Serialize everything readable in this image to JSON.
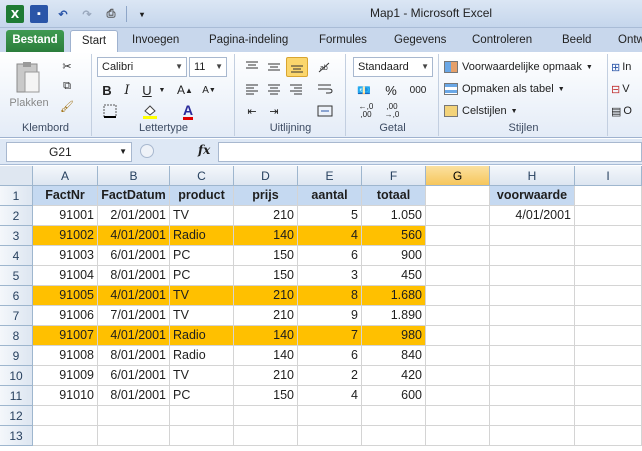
{
  "window": {
    "title": "Map1  -  Microsoft Excel"
  },
  "qat": {
    "app_icon": "excel-icon",
    "items": [
      "save-icon",
      "undo-icon",
      "redo-icon",
      "print-preview-icon"
    ]
  },
  "tabs": [
    {
      "label": "Bestand"
    },
    {
      "label": "Start"
    },
    {
      "label": "Invoegen"
    },
    {
      "label": "Pagina-indeling"
    },
    {
      "label": "Formules"
    },
    {
      "label": "Gegevens"
    },
    {
      "label": "Controleren"
    },
    {
      "label": "Beeld"
    },
    {
      "label": "Ontw"
    }
  ],
  "ribbon": {
    "clipboard": {
      "label": "Klembord",
      "paste": "Plakken"
    },
    "font": {
      "label": "Lettertype",
      "name": "Calibri",
      "size": "11",
      "bold": "B",
      "italic": "I",
      "underline": "U",
      "font_color": "A"
    },
    "alignment": {
      "label": "Uitlijning"
    },
    "number": {
      "label": "Getal",
      "format": "Standaard",
      "percent": "%",
      "thousands": "000"
    },
    "styles": {
      "label": "Stijlen",
      "conditional": "Voorwaardelijke opmaak",
      "table": "Opmaken als tabel",
      "cell_styles": "Celstijlen"
    },
    "cells": {
      "items": [
        "In",
        "V",
        "O"
      ]
    }
  },
  "formula_bar": {
    "name_box": "G21",
    "fx": "fx",
    "value": ""
  },
  "columns": [
    "A",
    "B",
    "C",
    "D",
    "E",
    "F",
    "G",
    "H",
    "I"
  ],
  "selected_column": "G",
  "rows": [
    "1",
    "2",
    "3",
    "4",
    "5",
    "6",
    "7",
    "8",
    "9",
    "10",
    "11",
    "12",
    "13"
  ],
  "headers": [
    "FactNr",
    "FactDatum",
    "product",
    "prijs",
    "aantal",
    "totaal"
  ],
  "data": [
    {
      "nr": "91001",
      "date": "2/01/2001",
      "product": "TV",
      "price": "210",
      "qty": "5",
      "total": "1.050",
      "hl": false
    },
    {
      "nr": "91002",
      "date": "4/01/2001",
      "product": "Radio",
      "price": "140",
      "qty": "4",
      "total": "560",
      "hl": true
    },
    {
      "nr": "91003",
      "date": "6/01/2001",
      "product": "PC",
      "price": "150",
      "qty": "6",
      "total": "900",
      "hl": false
    },
    {
      "nr": "91004",
      "date": "8/01/2001",
      "product": "PC",
      "price": "150",
      "qty": "3",
      "total": "450",
      "hl": false
    },
    {
      "nr": "91005",
      "date": "4/01/2001",
      "product": "TV",
      "price": "210",
      "qty": "8",
      "total": "1.680",
      "hl": true
    },
    {
      "nr": "91006",
      "date": "7/01/2001",
      "product": "TV",
      "price": "210",
      "qty": "9",
      "total": "1.890",
      "hl": false
    },
    {
      "nr": "91007",
      "date": "4/01/2001",
      "product": "Radio",
      "price": "140",
      "qty": "7",
      "total": "980",
      "hl": true
    },
    {
      "nr": "91008",
      "date": "8/01/2001",
      "product": "Radio",
      "price": "140",
      "qty": "6",
      "total": "840",
      "hl": false
    },
    {
      "nr": "91009",
      "date": "6/01/2001",
      "product": "TV",
      "price": "210",
      "qty": "2",
      "total": "420",
      "hl": false
    },
    {
      "nr": "91010",
      "date": "8/01/2001",
      "product": "PC",
      "price": "150",
      "qty": "4",
      "total": "600",
      "hl": false
    }
  ],
  "criteria": {
    "header": "voorwaarde",
    "value": "4/01/2001"
  },
  "colors": {
    "highlight": "#ffc000",
    "header_fill": "#c5d9f1",
    "file_tab": "#2b7e3c"
  }
}
